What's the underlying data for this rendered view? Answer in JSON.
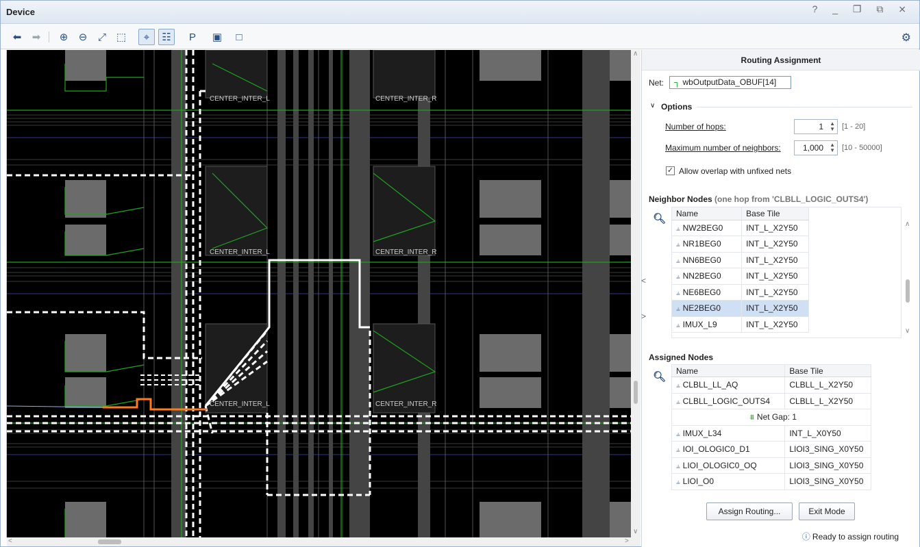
{
  "window": {
    "title": "Device",
    "controls": "? _ ❐ ⧉ ⨯"
  },
  "toolbar": {
    "back_icon": "arrow-left-icon",
    "forward_icon": "arrow-right-icon",
    "zoom_in_icon": "zoom-in-icon",
    "zoom_out_icon": "zoom-out-icon",
    "zoom_fit_icon": "zoom-fit-icon",
    "zoom_area_icon": "zoom-area-icon",
    "auto_fit_icon": "auto-fit-selection-icon",
    "routing_resources_icon": "routing-resources-icon",
    "place_icon": "place-ports-icon",
    "select_area_icon": "select-area-icon",
    "highlight_icon": "highlight-icon",
    "settings_icon": "gear-icon"
  },
  "device_view": {
    "tile_labels": [
      "CENTER_INTER_L",
      "CENTER_INTER_R",
      "CENTER_INTER_L",
      "CENTER_INTER_R",
      "CENTER_INTER_L",
      "CENTER_INTER_R"
    ]
  },
  "panel": {
    "title": "Routing Assignment",
    "net_label": "Net:",
    "net_value": "wbOutputData_OBUF[14]",
    "options_header": "Options",
    "hops_label": "Number of hops:",
    "hops_value": "1",
    "hops_range": "[1 - 20]",
    "neighbors_label": "Maximum number of neighbors:",
    "neighbors_value": "1,000",
    "neighbors_range": "[10 - 50000]",
    "overlap_label": "Allow overlap with unfixed nets",
    "overlap_checked": true,
    "neighbor_header": "Neighbor Nodes",
    "neighbor_subtitle": "(one hop from 'CLBLL_LOGIC_OUTS4')",
    "neighbor_columns": [
      "Name",
      "Base Tile"
    ],
    "neighbor_rows": [
      {
        "name": "NW2BEG0",
        "tile": "INT_L_X2Y50"
      },
      {
        "name": "NR1BEG0",
        "tile": "INT_L_X2Y50"
      },
      {
        "name": "NN6BEG0",
        "tile": "INT_L_X2Y50"
      },
      {
        "name": "NN2BEG0",
        "tile": "INT_L_X2Y50"
      },
      {
        "name": "NE6BEG0",
        "tile": "INT_L_X2Y50"
      },
      {
        "name": "NE2BEG0",
        "tile": "INT_L_X2Y50"
      },
      {
        "name": "IMUX_L9",
        "tile": "INT_L_X2Y50"
      }
    ],
    "assigned_header": "Assigned Nodes",
    "assigned_columns": [
      "Name",
      "Base Tile"
    ],
    "assigned_rows_a": [
      {
        "name": "CLBLL_LL_AQ",
        "tile": "CLBLL_L_X2Y50"
      },
      {
        "name": "CLBLL_LOGIC_OUTS4",
        "tile": "CLBLL_L_X2Y50"
      }
    ],
    "net_gap": "Net Gap: 1",
    "assigned_rows_b": [
      {
        "name": "IMUX_L34",
        "tile": "INT_L_X0Y50"
      },
      {
        "name": "IOI_OLOGIC0_D1",
        "tile": "LIOI3_SING_X0Y50"
      },
      {
        "name": "LIOI_OLOGIC0_OQ",
        "tile": "LIOI3_SING_X0Y50"
      },
      {
        "name": "LIOI_O0",
        "tile": "LIOI3_SING_X0Y50"
      }
    ],
    "assign_button": "Assign Routing...",
    "exit_button": "Exit Mode",
    "status": "Ready to assign routing"
  }
}
